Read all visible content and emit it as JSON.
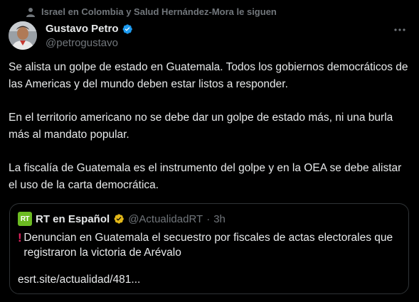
{
  "social_context": {
    "text": "Israel en Colombia y Salud Hernández-Mora le siguen"
  },
  "author": {
    "name": "Gustavo Petro",
    "handle": "@petrogustavo"
  },
  "tweet": {
    "paragraphs": [
      "Se alista un golpe de estado en Guatemala. Todos los gobiernos democráticos de las Americas y del mundo deben estar listos a responder.",
      "En el territorio americano no se debe dar un golpe de estado más, ni una burla más al mandato popular.",
      "La fiscalía de Guatemala es el instrumento del golpe y en la OEA se debe alistar el uso de la carta democrática."
    ]
  },
  "quote": {
    "logo_text": "RT",
    "name": "RT en Español",
    "handle": "@ActualidadRT",
    "separator": "·",
    "time": "3h",
    "exclamation": "!",
    "text": "Denuncian en Guatemala el secuestro por fiscales de actas electorales que registraron la victoria de Arévalo",
    "link": "esrt.site/actualidad/481..."
  },
  "colors": {
    "background": "#000000",
    "verified_blue": "#1d9bf0",
    "verified_gold": "#e2b719",
    "rt_green": "#6cbb22"
  },
  "icons": {
    "context": "person-icon",
    "verified": "verified-badge-icon",
    "more": "more-options-icon"
  }
}
